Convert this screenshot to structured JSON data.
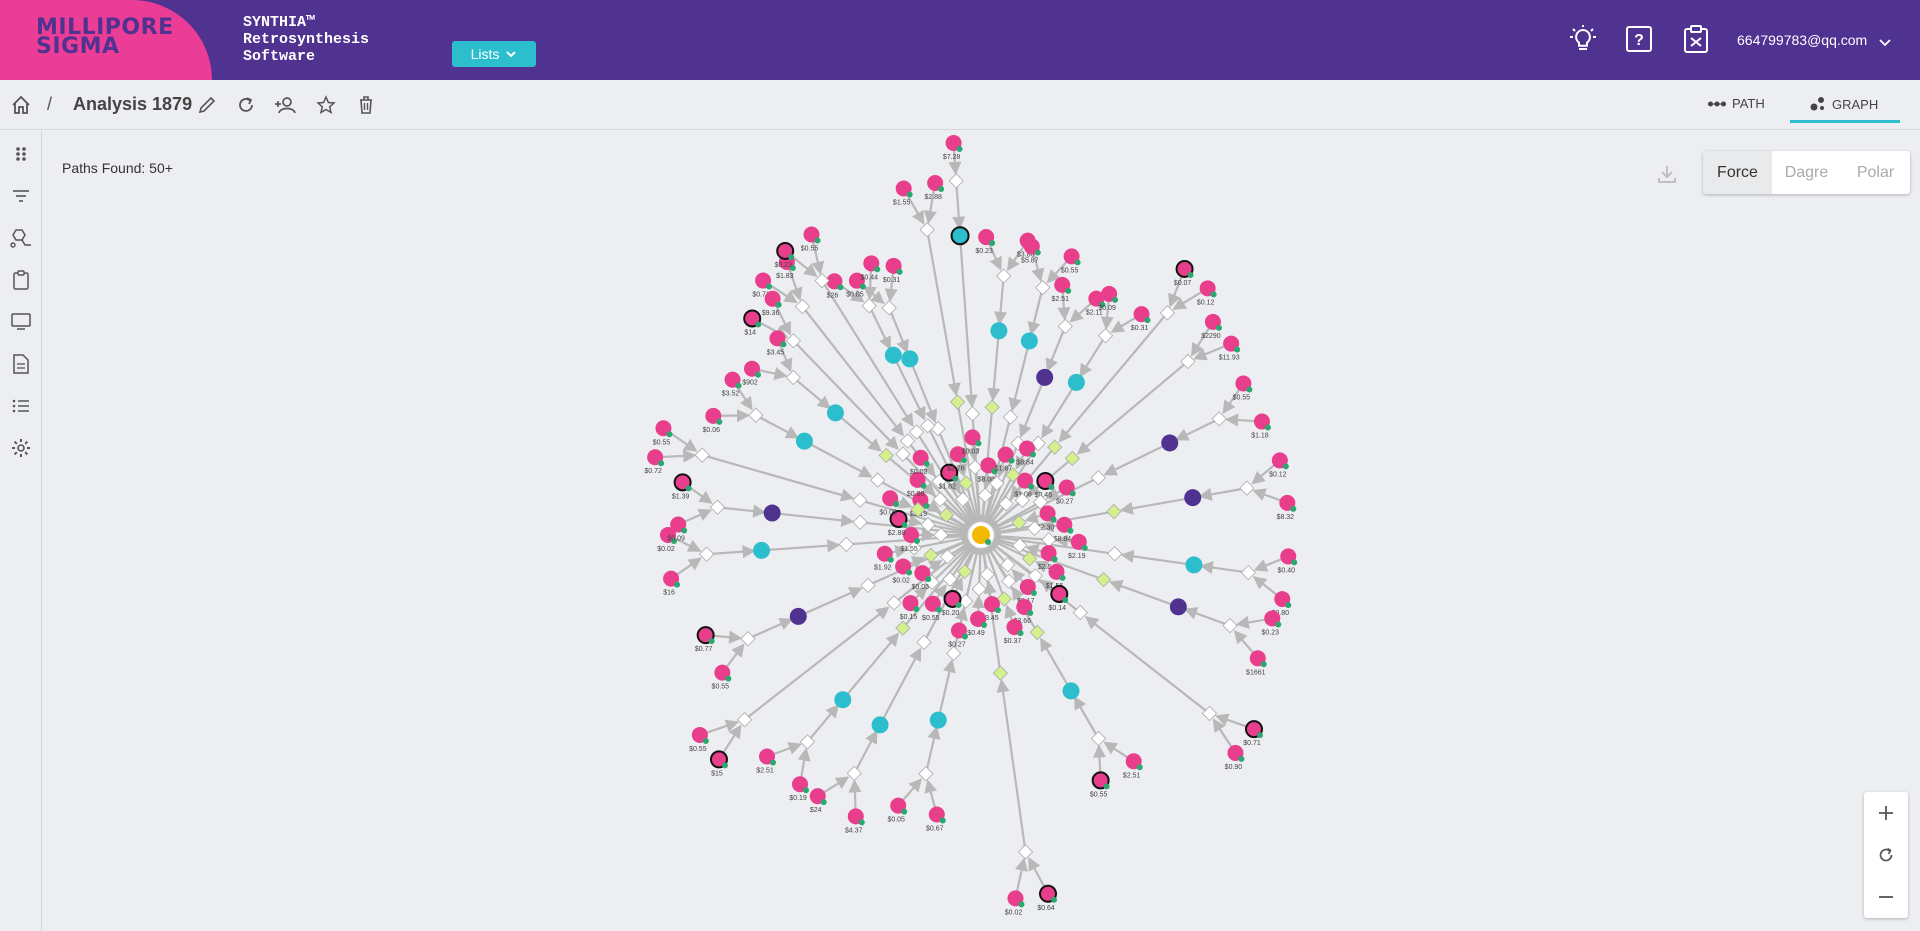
{
  "header": {
    "brand_logo": "MILLIPORE SIGMA",
    "product_line1": "SYNTHIA™",
    "product_line2": "Retrosynthesis",
    "product_line3": "Software",
    "lists_label": "Lists",
    "user_email": "664799783@qq.com",
    "icons": [
      "lightbulb-icon",
      "help-icon",
      "clipboard-icon",
      "chevron-down-icon"
    ]
  },
  "toolbar": {
    "separator": "/",
    "analysis_title": "Analysis 1879",
    "tabs": [
      {
        "label": "PATH",
        "active": false
      },
      {
        "label": "GRAPH",
        "active": true
      }
    ]
  },
  "sidebar": {
    "icons": [
      "grid-icon",
      "filter-icon",
      "molecule-icon",
      "clipboard-icon",
      "monitor-icon",
      "document-icon",
      "list-icon",
      "settings-icon"
    ]
  },
  "main": {
    "paths_found": "Paths Found: 50+",
    "layouts": [
      {
        "label": "Force",
        "active": true
      },
      {
        "label": "Dagre",
        "active": false
      },
      {
        "label": "Polar",
        "active": false
      }
    ]
  },
  "graph": {
    "colors": {
      "starting_material": "#e83e8c",
      "intermediate": "#2cbecd",
      "branch": "#503291",
      "target": "#f5b800",
      "edge": "#b8b8b8",
      "reaction": "#ffffff",
      "reaction_highlight": "#d4f08c"
    },
    "price_labels": [
      "$1.55",
      "$2.88",
      "$0.05",
      "$0.31",
      "$7.28",
      "$0.23",
      "$3.86",
      "$5.87",
      "$0.55",
      "$2.51",
      "$2.11",
      "$0.09",
      "$0.31",
      "$0.07",
      "$0.12",
      "$2290",
      "$11.93",
      "$0.55",
      "$1.18",
      "$0.12",
      "$8.32",
      "$0.40",
      "$0.80",
      "$0.23",
      "$1661",
      "$0.71",
      "$0.90",
      "$2.51",
      "$0.55",
      "$0.64",
      "$0.02",
      "$0.67",
      "$0.05",
      "$4.37",
      "$24",
      "$0.19",
      "$2.51",
      "$15",
      "$0.55",
      "$0.55",
      "$0.77",
      "$16",
      "$0.02",
      "$0.09",
      "$1.39",
      "$0.72",
      "$0.55",
      "$0.06",
      "$3.52",
      "$902",
      "$3.45",
      "$0.71",
      "$1.83",
      "$26",
      "$0.44",
      "$0.23",
      "$0.55",
      "$14",
      "$9.36",
      "$2.19",
      "$0.08",
      "$0.02",
      "$1.82",
      "$2.76",
      "$0.03",
      "$8.08",
      "$1.87",
      "$8.84",
      "$1.08",
      "$0.46",
      "$0.27",
      "$2.30",
      "$8.84",
      "$2.19",
      "$2.54",
      "$1.55",
      "$0.14",
      "$5.17",
      "$3.66",
      "$0.37",
      "$3.45",
      "$0.49",
      "$0.27",
      "$0.20",
      "$0.55",
      "$0.15",
      "$0.05",
      "$0.02",
      "$1.92"
    ]
  }
}
